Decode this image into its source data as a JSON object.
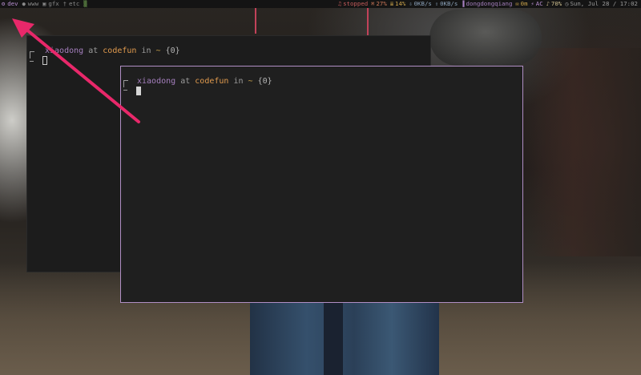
{
  "topbar": {
    "workspaces": [
      {
        "icon": "dev-icon",
        "glyph": "⚙",
        "label": "dev",
        "active": true
      },
      {
        "icon": "user-icon",
        "glyph": "●",
        "label": "www",
        "active": false
      },
      {
        "icon": "gfx-icon",
        "glyph": "▣",
        "label": "gfx",
        "active": false
      },
      {
        "icon": "etc-icon",
        "glyph": "†",
        "label": "etc",
        "active": false
      },
      {
        "icon": "grid-icon",
        "glyph": "▒",
        "label": "",
        "active": false
      }
    ],
    "status": [
      {
        "name": "music-status",
        "icon": "music-icon",
        "glyph": "♫",
        "text": "stopped",
        "color": "#c45b5b"
      },
      {
        "name": "cpu-status",
        "icon": "cpu-icon",
        "glyph": "⌘",
        "text": "27%",
        "color": "#d07a5a"
      },
      {
        "name": "memory-status",
        "icon": "memory-icon",
        "glyph": "≣",
        "text": "14%",
        "color": "#c9a24a"
      },
      {
        "name": "download-status",
        "icon": "download-icon",
        "glyph": "⇩",
        "text": "0KB/s",
        "color": "#8aa0b8"
      },
      {
        "name": "upload-status",
        "icon": "upload-icon",
        "glyph": "⇧",
        "text": "0KB/s",
        "color": "#8aa0b8"
      },
      {
        "name": "wifi-status",
        "icon": "wifi-icon",
        "glyph": "▐",
        "text": "dongdongqiang",
        "color": "#a57fbe"
      },
      {
        "name": "mail-status",
        "icon": "mail-icon",
        "glyph": "✉",
        "text": "0m",
        "color": "#c9a24a"
      },
      {
        "name": "power-status",
        "icon": "power-icon",
        "glyph": "⚡",
        "text": "AC",
        "color": "#b98fd2"
      },
      {
        "name": "volume-status",
        "icon": "volume-icon",
        "glyph": "♪",
        "text": "70%",
        "color": "#d0c090"
      },
      {
        "name": "clock-status",
        "icon": "clock-icon",
        "glyph": "◷",
        "text": "Sun, Jul 28 / 17:02",
        "color": "#9a9a9a"
      }
    ]
  },
  "terminal_back": {
    "user": "xiaodong",
    "at": "at",
    "host": "codefun",
    "in": "in",
    "dir": "~",
    "hist": "{0}"
  },
  "terminal_front": {
    "user": "xiaodong",
    "at": "at",
    "host": "codefun",
    "in": "in",
    "dir": "~",
    "hist": "{0}"
  },
  "colors": {
    "accent_border": "#b08ec4",
    "arrow": "#e8286a"
  }
}
